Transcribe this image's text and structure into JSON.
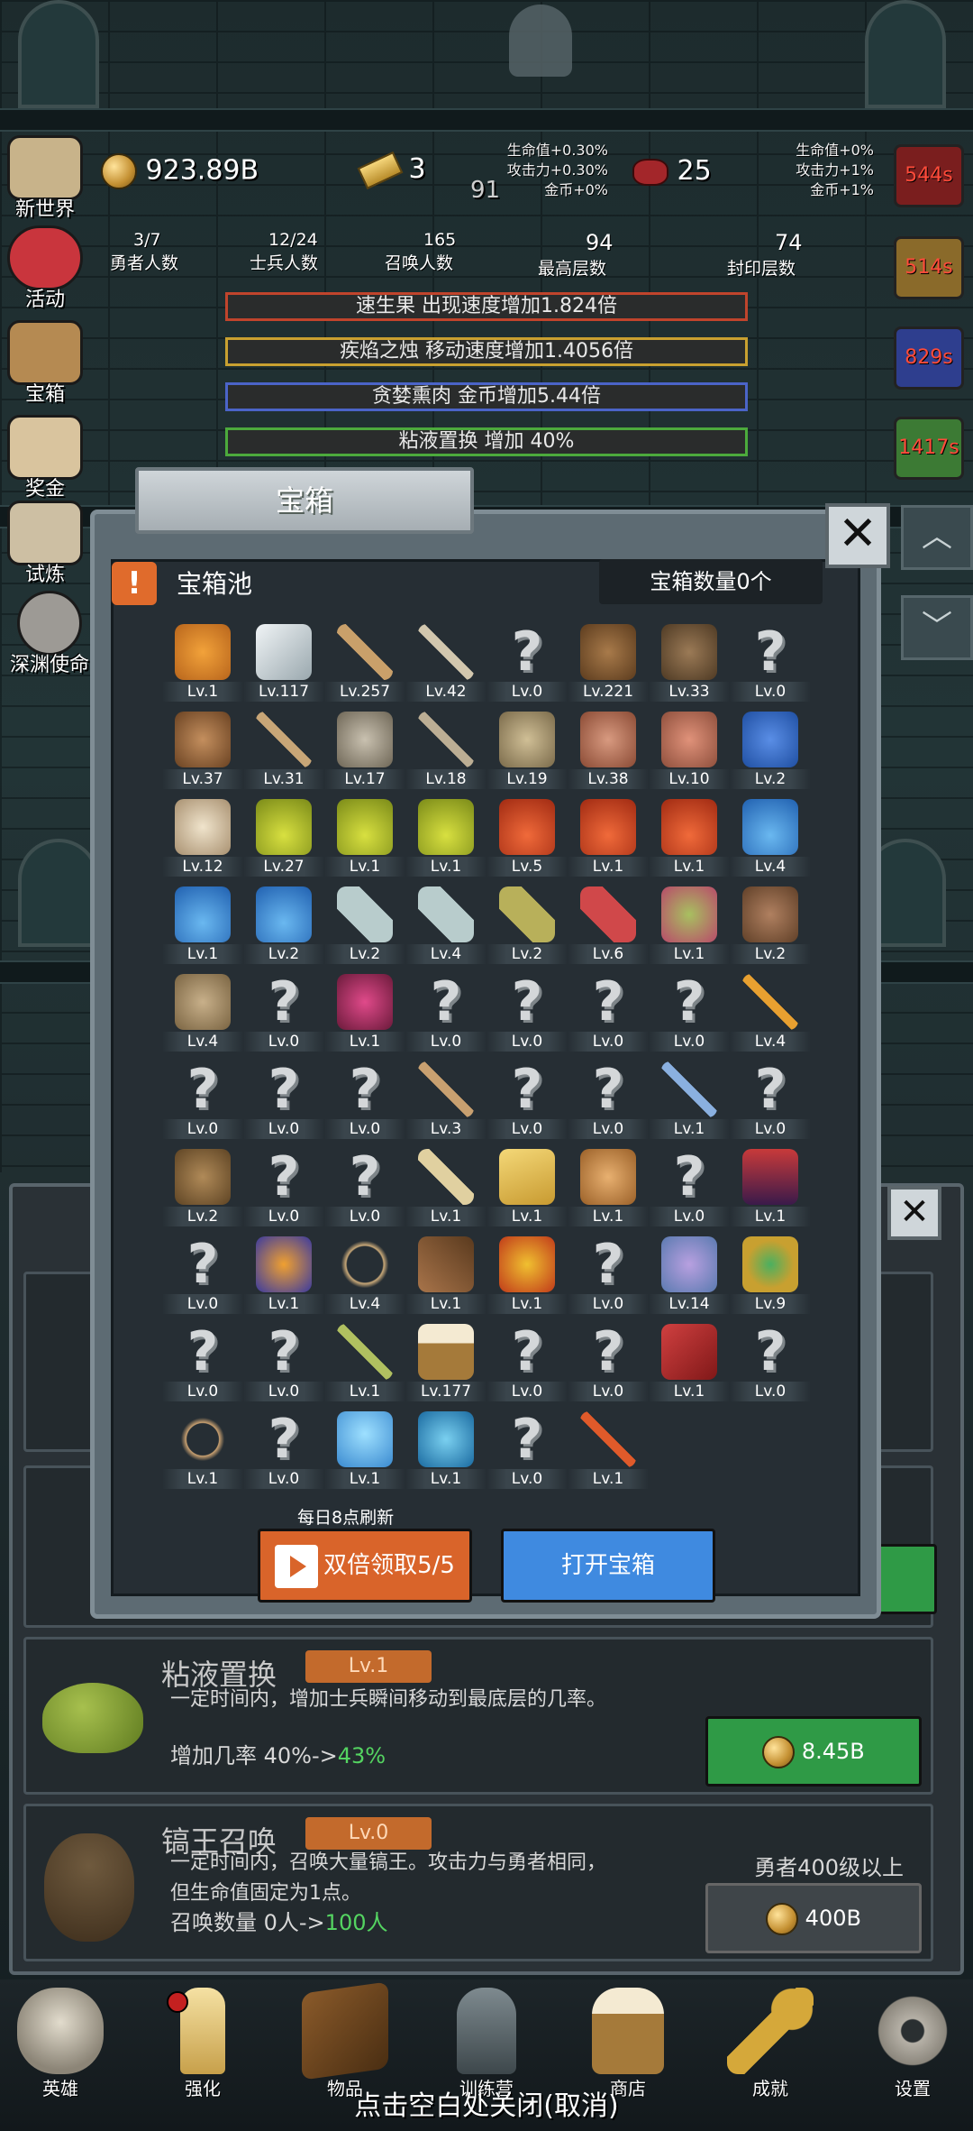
{
  "resources": {
    "gold": "923.89B",
    "gold_bars": "3",
    "floor_mid": "91",
    "meat": "25",
    "left_bonus": [
      "生命值+0.30%",
      "攻击力+0.30%",
      "金币+0%"
    ],
    "right_bonus": [
      "生命值+0%",
      "攻击力+1%",
      "金币+1%"
    ]
  },
  "counters": [
    {
      "value": "3/7",
      "label": "勇者人数"
    },
    {
      "value": "12/24",
      "label": "士兵人数"
    },
    {
      "value": "165",
      "label": "召唤人数"
    },
    {
      "value": "94",
      "label": "最高层数"
    },
    {
      "value": "74",
      "label": "封印层数"
    }
  ],
  "side_menu": [
    "新世界",
    "活动",
    "宝箱",
    "奖金",
    "试炼",
    "深渊使命"
  ],
  "buffs": [
    {
      "text": "速生果 出现速度增加1.824倍",
      "color": "#c0442c",
      "timer": "544s"
    },
    {
      "text": "疾焰之烛 移动速度增加1.4056倍",
      "color": "#c8a030",
      "timer": "514s"
    },
    {
      "text": "贪婪熏肉 金币增加5.44倍",
      "color": "#4b64c8",
      "timer": "829s"
    },
    {
      "text": "粘液置换 增加 40%",
      "color": "#4caa3c",
      "timer": "1417s"
    }
  ],
  "upgrades": [
    {
      "name": "粘液置换",
      "level": "Lv.1",
      "desc": "一定时间内，增加士兵瞬间移动到最底层的几率。",
      "effect_prefix": "增加几率 40%->",
      "effect_next": "43%",
      "cost": "8.45B"
    },
    {
      "name": "镐王召唤",
      "level": "Lv.0",
      "desc1": "一定时间内，召唤大量镐王。攻击力与勇者相同，",
      "desc2": "但生命值固定为1点。",
      "effect_prefix": "召唤数量 0人->",
      "effect_next": "100人",
      "requirement": "勇者400级以上",
      "cost": "400B"
    }
  ],
  "modal": {
    "title": "宝箱",
    "pool_title": "宝箱池",
    "count_label": "宝箱数量0个",
    "daily_refresh": "每日8点刷新",
    "double_btn": "双倍领取5/5",
    "open_btn": "打开宝箱",
    "items": [
      {
        "icon": "crown",
        "lv": "Lv.1"
      },
      {
        "icon": "diamond",
        "lv": "Lv.117"
      },
      {
        "icon": "wooden-sword",
        "lv": "Lv.257"
      },
      {
        "icon": "short-sword",
        "lv": "Lv.42"
      },
      {
        "icon": "unknown",
        "lv": "Lv.0"
      },
      {
        "icon": "leather-armor",
        "lv": "Lv.221"
      },
      {
        "icon": "backpack-armor",
        "lv": "Lv.33"
      },
      {
        "icon": "unknown",
        "lv": "Lv.0"
      },
      {
        "icon": "leather-helmet",
        "lv": "Lv.37"
      },
      {
        "icon": "dagger",
        "lv": "Lv.31"
      },
      {
        "icon": "knight-helmet",
        "lv": "Lv.17"
      },
      {
        "icon": "hammer",
        "lv": "Lv.18"
      },
      {
        "icon": "great-helm",
        "lv": "Lv.19"
      },
      {
        "icon": "ham",
        "lv": "Lv.38"
      },
      {
        "icon": "steak",
        "lv": "Lv.10"
      },
      {
        "icon": "money-bag",
        "lv": "Lv.2"
      },
      {
        "icon": "bread",
        "lv": "Lv.12"
      },
      {
        "icon": "yellow-potion",
        "lv": "Lv.27"
      },
      {
        "icon": "yellow-potion",
        "lv": "Lv.1"
      },
      {
        "icon": "yellow-potion",
        "lv": "Lv.1"
      },
      {
        "icon": "red-potion",
        "lv": "Lv.5"
      },
      {
        "icon": "red-potion",
        "lv": "Lv.1"
      },
      {
        "icon": "red-potion",
        "lv": "Lv.1"
      },
      {
        "icon": "blue-potion",
        "lv": "Lv.4"
      },
      {
        "icon": "blue-potion",
        "lv": "Lv.1"
      },
      {
        "icon": "blue-potion",
        "lv": "Lv.2"
      },
      {
        "icon": "empty-bottle",
        "lv": "Lv.2"
      },
      {
        "icon": "empty-bottle",
        "lv": "Lv.4"
      },
      {
        "icon": "yellow-bottle",
        "lv": "Lv.2"
      },
      {
        "icon": "red-bottle",
        "lv": "Lv.6"
      },
      {
        "icon": "winged-boot",
        "lv": "Lv.1"
      },
      {
        "icon": "boot",
        "lv": "Lv.2"
      },
      {
        "icon": "shoe",
        "lv": "Lv.4"
      },
      {
        "icon": "unknown",
        "lv": "Lv.0"
      },
      {
        "icon": "pink-boots",
        "lv": "Lv.1"
      },
      {
        "icon": "unknown",
        "lv": "Lv.0"
      },
      {
        "icon": "unknown",
        "lv": "Lv.0"
      },
      {
        "icon": "unknown",
        "lv": "Lv.0"
      },
      {
        "icon": "unknown",
        "lv": "Lv.0"
      },
      {
        "icon": "torch",
        "lv": "Lv.4"
      },
      {
        "icon": "unknown",
        "lv": "Lv.0"
      },
      {
        "icon": "unknown",
        "lv": "Lv.0"
      },
      {
        "icon": "unknown",
        "lv": "Lv.0"
      },
      {
        "icon": "wooden-staff",
        "lv": "Lv.3"
      },
      {
        "icon": "unknown",
        "lv": "Lv.0"
      },
      {
        "icon": "unknown",
        "lv": "Lv.0"
      },
      {
        "icon": "magic-wand",
        "lv": "Lv.1"
      },
      {
        "icon": "unknown",
        "lv": "Lv.0"
      },
      {
        "icon": "leather-bag",
        "lv": "Lv.2"
      },
      {
        "icon": "unknown",
        "lv": "Lv.0"
      },
      {
        "icon": "unknown",
        "lv": "Lv.0"
      },
      {
        "icon": "club",
        "lv": "Lv.1"
      },
      {
        "icon": "cheese",
        "lv": "Lv.1"
      },
      {
        "icon": "pie",
        "lv": "Lv.1"
      },
      {
        "icon": "unknown",
        "lv": "Lv.0"
      },
      {
        "icon": "dark-pyramid",
        "lv": "Lv.1"
      },
      {
        "icon": "unknown",
        "lv": "Lv.0"
      },
      {
        "icon": "magic-cube",
        "lv": "Lv.1"
      },
      {
        "icon": "bow",
        "lv": "Lv.4"
      },
      {
        "icon": "quiver",
        "lv": "Lv.1"
      },
      {
        "icon": "fire-gauntlet",
        "lv": "Lv.1"
      },
      {
        "icon": "unknown",
        "lv": "Lv.0"
      },
      {
        "icon": "crystal-ring",
        "lv": "Lv.14"
      },
      {
        "icon": "gold-shield",
        "lv": "Lv.9"
      },
      {
        "icon": "unknown",
        "lv": "Lv.0"
      },
      {
        "icon": "unknown",
        "lv": "Lv.0"
      },
      {
        "icon": "green-scepter",
        "lv": "Lv.1"
      },
      {
        "icon": "beer-mug",
        "lv": "Lv.177"
      },
      {
        "icon": "unknown",
        "lv": "Lv.0"
      },
      {
        "icon": "unknown",
        "lv": "Lv.0"
      },
      {
        "icon": "red-book",
        "lv": "Lv.1"
      },
      {
        "icon": "unknown",
        "lv": "Lv.0"
      },
      {
        "icon": "rope",
        "lv": "Lv.1"
      },
      {
        "icon": "unknown",
        "lv": "Lv.0"
      },
      {
        "icon": "crystal-orb",
        "lv": "Lv.1"
      },
      {
        "icon": "rune-disk",
        "lv": "Lv.1"
      },
      {
        "icon": "unknown",
        "lv": "Lv.0"
      },
      {
        "icon": "fire-arrow",
        "lv": "Lv.1"
      }
    ]
  },
  "nav": [
    "英雄",
    "强化",
    "物品",
    "训练营",
    "商店",
    "成就",
    "设置"
  ],
  "close_hint": "点击空白处关闭(取消)",
  "colors": {
    "accent_orange": "#e06b2c",
    "accent_blue": "#3f8ae0",
    "btn_green": "#2f9a46"
  }
}
